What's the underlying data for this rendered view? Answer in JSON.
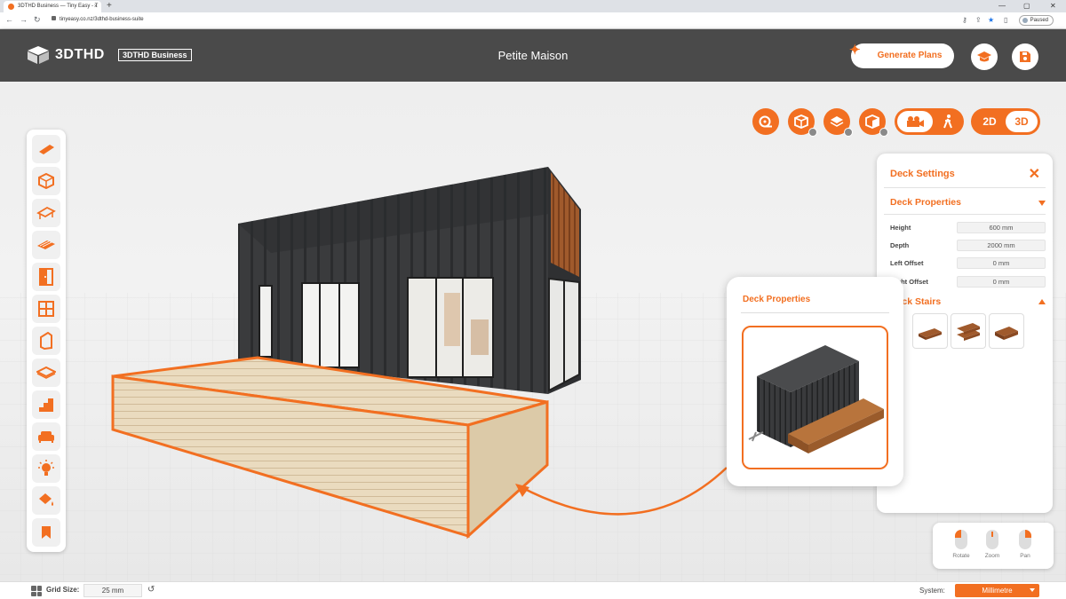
{
  "browser": {
    "tab_title": "3DTHD Business — Tiny Easy - T",
    "tab_close": "×",
    "new_tab": "+",
    "url": "tinyeasy.co.nz/3dthd-business-suite",
    "paused_label": "Paused",
    "back": "←",
    "forward": "→",
    "reload": "↻"
  },
  "header": {
    "logo_text": "3DTHD",
    "badge": "3DTHD Business",
    "project_title": "Petite Maison",
    "generate_plans": "Generate Plans",
    "spark": "✦"
  },
  "view_toggle": {
    "label_2d": "2D",
    "label_3d": "3D"
  },
  "left_tools": [
    "roof-tool-icon",
    "cube-tool-icon",
    "gable-roof-icon",
    "deck-tool-icon",
    "door-tool-icon",
    "window-tool-icon",
    "wall-panel-icon",
    "floor-tool-icon",
    "stairs-tool-icon",
    "sofa-tool-icon",
    "light-tool-icon",
    "paint-tool-icon",
    "bookmark-tool-icon"
  ],
  "deck_settings": {
    "title": "Deck Settings",
    "close": "✕",
    "properties_heading": "Deck Properties",
    "fields": [
      {
        "label": "Height",
        "value": "600 mm"
      },
      {
        "label": "Depth",
        "value": "2000 mm"
      },
      {
        "label": "Left Offset",
        "value": "0 mm"
      },
      {
        "label": "Right Offset",
        "value": "0 mm"
      }
    ],
    "stairs_heading": "Deck Stairs"
  },
  "popup": {
    "title": "Deck Properties"
  },
  "mouse_help": {
    "rotate": "Rotate",
    "zoom": "Zoom",
    "pan": "Pan"
  },
  "status": {
    "grid_label": "Grid Size:",
    "grid_value": "25 mm",
    "system_label": "System:",
    "system_value": "Millimetre"
  },
  "colors": {
    "accent": "#f26f21",
    "header_bg": "#4a4a4a",
    "container": "#3a3b3d",
    "deck": "#e9d7b8",
    "timber": "#a05a2c"
  }
}
